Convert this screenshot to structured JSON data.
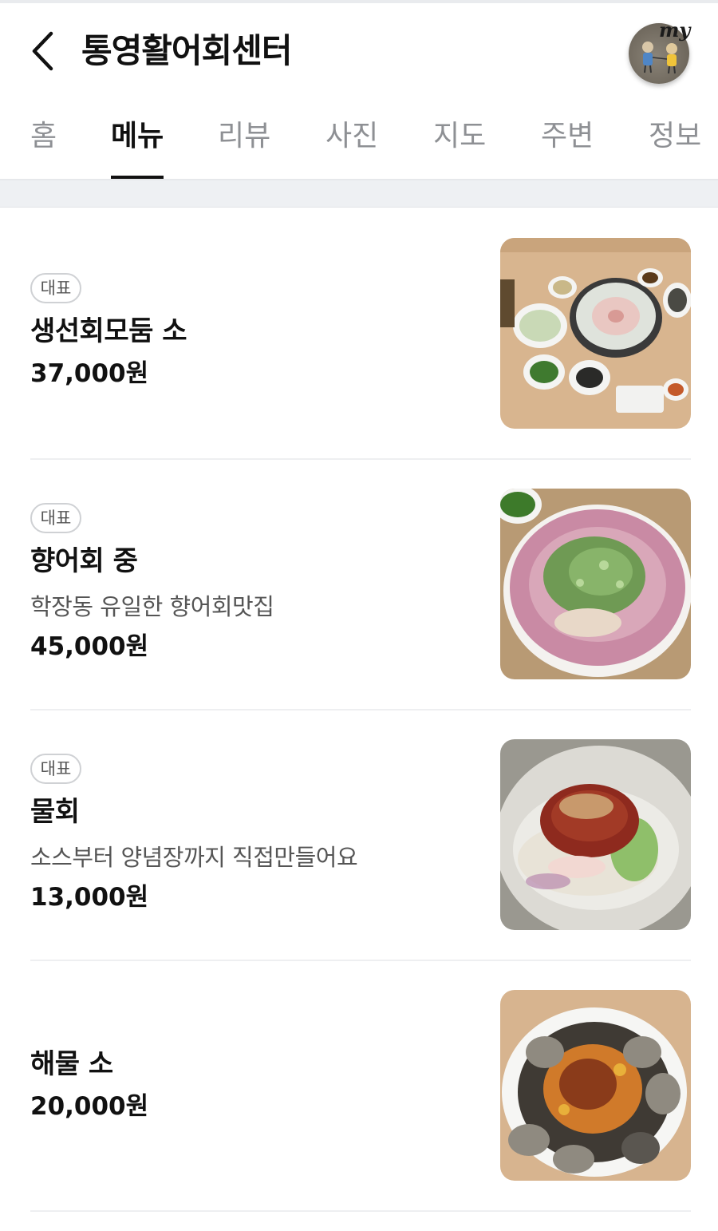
{
  "header": {
    "title": "통영활어회센터",
    "avatar_label": "my"
  },
  "tabs": [
    {
      "label": "홈",
      "active": false
    },
    {
      "label": "메뉴",
      "active": true
    },
    {
      "label": "리뷰",
      "active": false
    },
    {
      "label": "사진",
      "active": false
    },
    {
      "label": "지도",
      "active": false
    },
    {
      "label": "주변",
      "active": false
    },
    {
      "label": "정보",
      "active": false
    }
  ],
  "menu": [
    {
      "badge": "대표",
      "name": "생선회모둠 소",
      "description": "",
      "price": "37,000원",
      "photo": "sashimi-platter"
    },
    {
      "badge": "대표",
      "name": "향어회 중",
      "description": "학장동 유일한 향어회맛집",
      "price": "45,000원",
      "photo": "carp-sashimi"
    },
    {
      "badge": "대표",
      "name": "물회",
      "description": "소스부터 양념장까지 직접만들어요",
      "price": "13,000원",
      "photo": "mulhoe"
    },
    {
      "badge": "",
      "name": "해물 소",
      "description": "",
      "price": "20,000원",
      "photo": "seafood-platter"
    }
  ]
}
